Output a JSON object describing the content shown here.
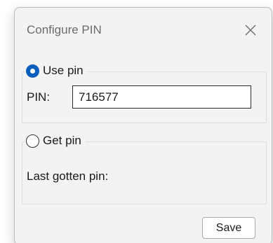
{
  "window": {
    "title": "Configure PIN",
    "close_icon": "close-icon"
  },
  "use_pin_group": {
    "label": "Use pin",
    "selected": true,
    "pin_label": "PIN:",
    "pin_value": "716577"
  },
  "get_pin_group": {
    "label": "Get pin",
    "selected": false,
    "last_label": "Last gotten pin:"
  },
  "footer": {
    "save_label": "Save"
  },
  "colors": {
    "accent": "#0a5fbd",
    "dialog_bg": "#f3f3f3"
  }
}
